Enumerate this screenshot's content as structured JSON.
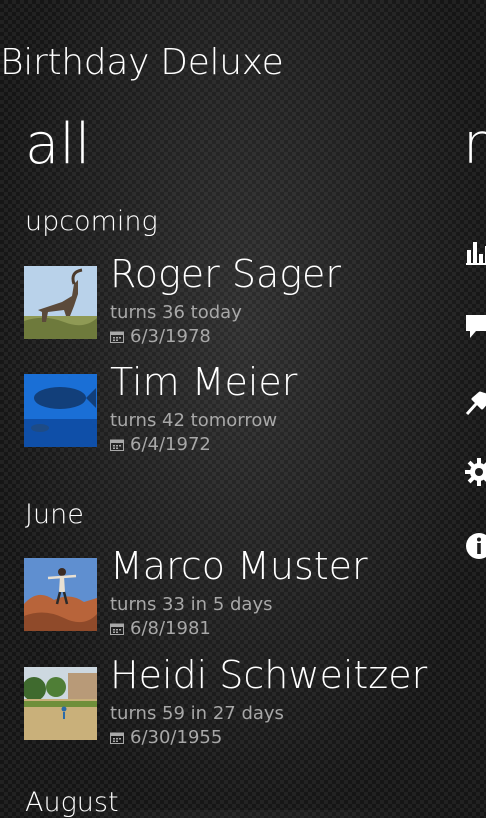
{
  "app": {
    "title": "Birthday Deluxe"
  },
  "pivot": {
    "current": "all",
    "next": "n"
  },
  "groups": [
    {
      "header": "upcoming",
      "contacts": [
        {
          "name": "Roger Sager",
          "turns": "turns 36 today",
          "date": "6/3/1978",
          "photo": "ibex-photo"
        },
        {
          "name": "Tim Meier",
          "turns": "turns 42 tomorrow",
          "date": "6/4/1972",
          "photo": "fish-photo"
        }
      ]
    },
    {
      "header": "June",
      "contacts": [
        {
          "name": "Marco Muster",
          "turns": "turns 33 in 5 days",
          "date": "6/8/1981",
          "photo": "rock-photo"
        },
        {
          "name": "Heidi Schweitzer",
          "turns": "turns 59 in 27 days",
          "date": "6/30/1955",
          "photo": "park-photo"
        }
      ]
    },
    {
      "header": "August",
      "contacts": []
    }
  ],
  "side_icons": [
    "bar-chart-icon",
    "comment-icon",
    "pin-icon",
    "gear-icon",
    "info-icon"
  ],
  "colors": {
    "background": "#1e1e1e",
    "text": "#ffffff",
    "secondary_text": "#a8a8a8"
  }
}
